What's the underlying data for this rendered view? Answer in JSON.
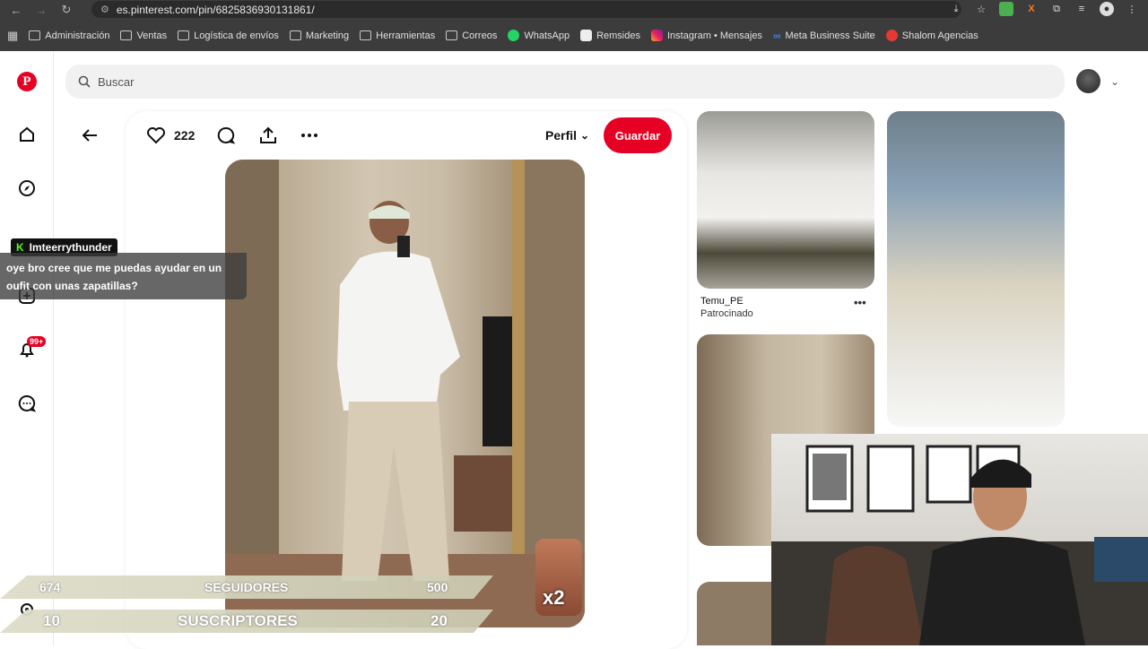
{
  "browser": {
    "url": "es.pinterest.com/pin/6825836930131861/",
    "bookmarks": [
      {
        "label": "Administración",
        "icon": "folder-icon"
      },
      {
        "label": "Ventas",
        "icon": "folder-icon"
      },
      {
        "label": "Logística de envíos",
        "icon": "folder-icon"
      },
      {
        "label": "Marketing",
        "icon": "folder-icon"
      },
      {
        "label": "Herramientas",
        "icon": "folder-icon"
      },
      {
        "label": "Correos",
        "icon": "folder-icon"
      },
      {
        "label": "WhatsApp",
        "icon": "whatsapp-icon"
      },
      {
        "label": "Remsides",
        "icon": "bookmark-app-icon"
      },
      {
        "label": "Instagram • Mensajes",
        "icon": "instagram-icon"
      },
      {
        "label": "Meta Business Suite",
        "icon": "meta-icon"
      },
      {
        "label": "Shalom Agencias",
        "icon": "shalom-icon"
      }
    ]
  },
  "pinterest": {
    "search_placeholder": "Buscar",
    "notifications_badge": "99+",
    "pin": {
      "like_count": "222",
      "profile_label": "Perfil",
      "save_label": "Guardar"
    },
    "related": {
      "sponsor_name": "Temu_PE",
      "sponsor_sub": "Patrocinado",
      "more": "•••"
    }
  },
  "stream": {
    "chat_user": "Imteerrythunder",
    "chat_message": "oye bro cree que me puedas ayudar en un oufit con unas zapatillas?",
    "followers": {
      "current": "674",
      "label": "SEGUIDORES",
      "goal": "500"
    },
    "subscribers": {
      "current": "10",
      "label": "SUSCRIPTORES",
      "goal": "20"
    },
    "emote_multiplier": "x2"
  },
  "colors": {
    "pinterest_red": "#e60023",
    "chrome_dark": "#3c3c3c",
    "kick_green": "#53fc18"
  }
}
